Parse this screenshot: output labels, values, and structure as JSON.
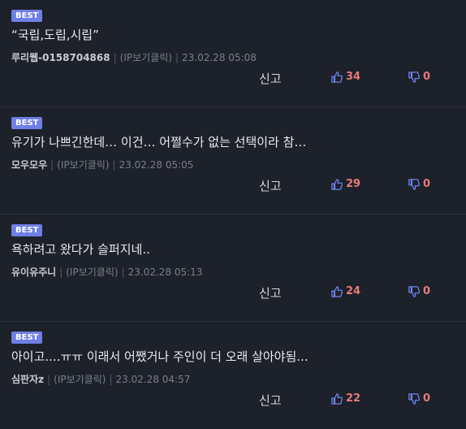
{
  "colors": {
    "background": "#1d2129",
    "best_badge": "#6f7fe6",
    "thumb_icon": "#6c84f0",
    "count": "#e87a7a"
  },
  "comments": [
    {
      "badge": "BEST",
      "text": "“국립,도립,시립”",
      "nickname": "루리웹-0158704868",
      "ip": "(IP보기클릭)",
      "time": "23.02.28 05:08",
      "report": "신고",
      "up": "34",
      "down": "0"
    },
    {
      "badge": "BEST",
      "text": "유기가 나쁘긴한데… 이건… 어쩔수가 없는 선택이라 참…",
      "nickname": "모우모우",
      "ip": "(IP보기클릭)",
      "time": "23.02.28 05:05",
      "report": "신고",
      "up": "29",
      "down": "0"
    },
    {
      "badge": "BEST",
      "text": "욕하려고 왔다가 슬퍼지네..",
      "nickname": "유이유주니",
      "ip": "(IP보기클릭)",
      "time": "23.02.28 05:13",
      "report": "신고",
      "up": "24",
      "down": "0"
    },
    {
      "badge": "BEST",
      "text": "아이고....ㅠㅠ 이래서 어쨌거나 주인이 더 오래 살아야됨...",
      "nickname": "심판자z",
      "ip": "(IP보기클릭)",
      "time": "23.02.28 04:57",
      "report": "신고",
      "up": "22",
      "down": "0"
    }
  ]
}
